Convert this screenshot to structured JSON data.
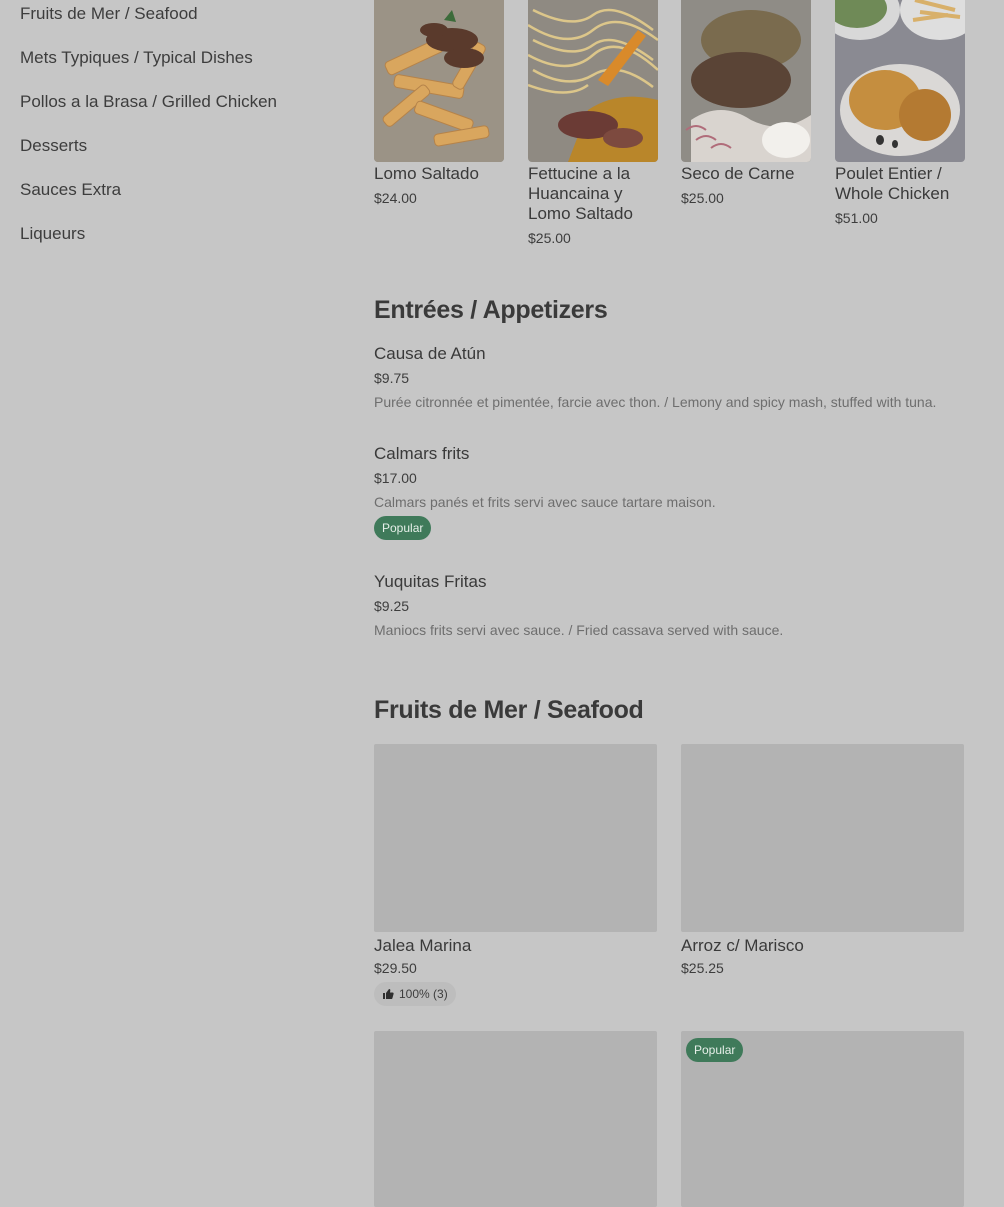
{
  "sidebar": {
    "items": [
      {
        "label": "Fruits de Mer / Seafood"
      },
      {
        "label": "Mets Typiques / Typical Dishes"
      },
      {
        "label": "Pollos a la Brasa / Grilled Chicken"
      },
      {
        "label": "Desserts"
      },
      {
        "label": "Sauces Extra"
      },
      {
        "label": "Liqueurs"
      }
    ]
  },
  "featured": {
    "items": [
      {
        "name": "Lomo Saltado",
        "price": "$24.00"
      },
      {
        "name": "Fettucine a la Huancaina y Lomo Saltado",
        "price": "$25.00"
      },
      {
        "name": "Seco de Carne",
        "price": "$25.00"
      },
      {
        "name": "Poulet Entier / Whole Chicken",
        "price": "$51.00"
      }
    ]
  },
  "appetizers": {
    "title": "Entrées / Appetizers",
    "items": [
      {
        "name": "Causa de Atún",
        "price": "$9.75",
        "description": "Purée citronnée et pimentée, farcie avec thon. / Lemony and spicy mash, stuffed with tuna."
      },
      {
        "name": "Calmars frits",
        "price": "$17.00",
        "description": "Calmars panés et frits servi avec sauce tartare maison.",
        "badge": "Popular"
      },
      {
        "name": "Yuquitas Fritas",
        "price": "$9.25",
        "description": "Maniocs frits servi avec sauce. / Fried cassava served with sauce."
      }
    ]
  },
  "seafood": {
    "title": "Fruits de Mer / Seafood",
    "items": [
      {
        "name": "Jalea Marina",
        "price": "$29.50",
        "rating": "100% (3)"
      },
      {
        "name": "Arroz c/ Marisco",
        "price": "$25.25"
      }
    ],
    "next_badge": "Popular"
  },
  "colors": {
    "background": "#c6c6c6",
    "accent_green": "#3f7a5a",
    "placeholder": "#b3b3b3"
  }
}
